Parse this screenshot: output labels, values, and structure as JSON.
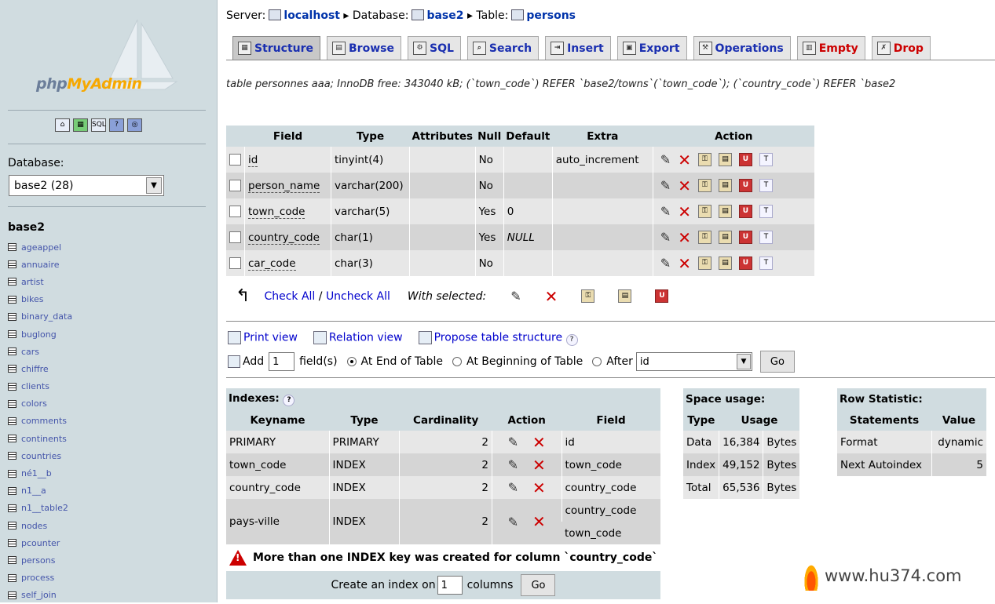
{
  "logo": {
    "text_a": "php",
    "text_b": "MyAdmin"
  },
  "sidebar": {
    "db_label": "Database:",
    "db_select": "base2 (28)",
    "db_name": "base2",
    "tables": [
      "ageappel",
      "annuaire",
      "artist",
      "bikes",
      "binary_data",
      "buglong",
      "cars",
      "chiffre",
      "clients",
      "colors",
      "comments",
      "continents",
      "countries",
      "né1__b",
      "n1__a",
      "n1__table2",
      "nodes",
      "pcounter",
      "persons",
      "process",
      "self_join"
    ]
  },
  "breadcrumb": {
    "server_label": "Server:",
    "server": "localhost",
    "db_label": "Database:",
    "db": "base2",
    "table_label": "Table:",
    "table": "persons"
  },
  "tabs": [
    {
      "label": "Structure",
      "color": "blue"
    },
    {
      "label": "Browse",
      "color": "blue"
    },
    {
      "label": "SQL",
      "color": "blue"
    },
    {
      "label": "Search",
      "color": "blue"
    },
    {
      "label": "Insert",
      "color": "blue"
    },
    {
      "label": "Export",
      "color": "blue"
    },
    {
      "label": "Operations",
      "color": "blue"
    },
    {
      "label": "Empty",
      "color": "red"
    },
    {
      "label": "Drop",
      "color": "red"
    }
  ],
  "comment": "table personnes aaa; InnoDB free: 343040 kB; (`town_code`) REFER `base2/towns`(`town_code`); (`country_code`) REFER `base2",
  "structure": {
    "headers": [
      "Field",
      "Type",
      "Attributes",
      "Null",
      "Default",
      "Extra",
      "Action"
    ],
    "rows": [
      {
        "field": "id",
        "type": "tinyint(4)",
        "attributes": "",
        "null": "No",
        "default": "",
        "extra": "auto_increment"
      },
      {
        "field": "person_name",
        "type": "varchar(200)",
        "attributes": "",
        "null": "No",
        "default": "",
        "extra": ""
      },
      {
        "field": "town_code",
        "type": "varchar(5)",
        "attributes": "",
        "null": "Yes",
        "default": "0",
        "extra": ""
      },
      {
        "field": "country_code",
        "type": "char(1)",
        "attributes": "",
        "null": "Yes",
        "default": "NULL",
        "extra": ""
      },
      {
        "field": "car_code",
        "type": "char(3)",
        "attributes": "",
        "null": "No",
        "default": "",
        "extra": ""
      }
    ]
  },
  "check": {
    "check_all": "Check All",
    "separator": "/",
    "uncheck_all": "Uncheck All",
    "with_selected": "With selected:"
  },
  "links": {
    "print": "Print view",
    "relation": "Relation view",
    "propose": "Propose table structure"
  },
  "add": {
    "label": "Add",
    "count": "1",
    "fields": "field(s)",
    "end": "At End of Table",
    "begin": "At Beginning of Table",
    "after": "After",
    "after_value": "id",
    "go": "Go"
  },
  "indexes": {
    "title": "Indexes:",
    "headers": [
      "Keyname",
      "Type",
      "Cardinality",
      "Action",
      "Field"
    ],
    "rows": [
      {
        "keyname": "PRIMARY",
        "type": "PRIMARY",
        "cardinality": "2",
        "fields": [
          "id"
        ]
      },
      {
        "keyname": "town_code",
        "type": "INDEX",
        "cardinality": "2",
        "fields": [
          "town_code"
        ]
      },
      {
        "keyname": "country_code",
        "type": "INDEX",
        "cardinality": "2",
        "fields": [
          "country_code"
        ]
      },
      {
        "keyname": "pays-ville",
        "type": "INDEX",
        "cardinality": "2",
        "fields": [
          "country_code",
          "town_code"
        ]
      }
    ],
    "warning": "More than one INDEX key was created for column `country_code`",
    "create_label": "Create an index on",
    "create_count": "1",
    "create_columns": "columns",
    "create_go": "Go"
  },
  "space": {
    "title": "Space usage:",
    "headers": [
      "Type",
      "Usage"
    ],
    "rows": [
      [
        "Data",
        "16,384",
        "Bytes"
      ],
      [
        "Index",
        "49,152",
        "Bytes"
      ],
      [
        "Total",
        "65,536",
        "Bytes"
      ]
    ]
  },
  "rowstats": {
    "title": "Row Statistic:",
    "headers": [
      "Statements",
      "Value"
    ],
    "rows": [
      [
        "Format",
        "dynamic"
      ],
      [
        "Next Autoindex",
        "5"
      ]
    ]
  },
  "watermark": "www.hu374.com"
}
